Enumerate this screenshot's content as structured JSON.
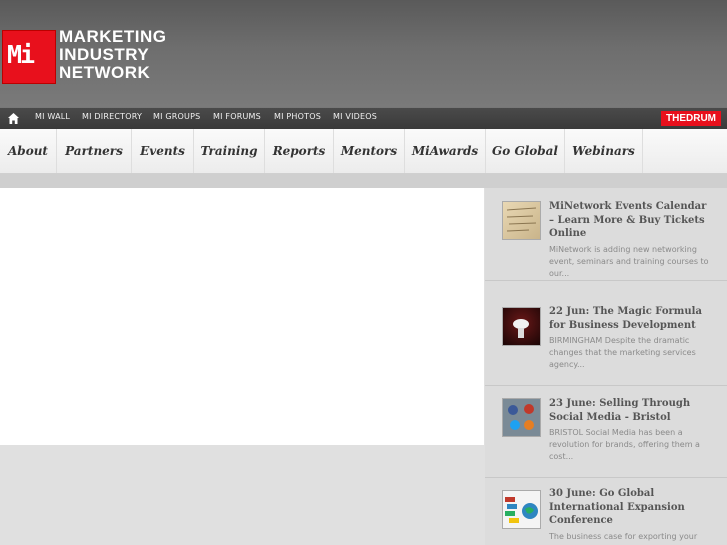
{
  "brand": {
    "logo_mark": "Mi",
    "name_lines": [
      "MARKETING",
      "INDUSTRY",
      "NETWORK"
    ]
  },
  "topnav": {
    "items": [
      "MI WALL",
      "MI DIRECTORY",
      "MI GROUPS",
      "MI FORUMS",
      "MI PHOTOS",
      "MI VIDEOS"
    ],
    "badge": "THEDRUM"
  },
  "mainnav": {
    "items": [
      "About",
      "Partners",
      "Events",
      "Training",
      "Reports",
      "Mentors",
      "MiAwards",
      "Go Global",
      "Webinars"
    ]
  },
  "sidebar": {
    "news": [
      {
        "title": "MiNetwork Events Calendar – Learn More & Buy Tickets Online",
        "excerpt": "MiNetwork is adding new networking event, seminars and training courses to our...",
        "thumb_icon": "calendar-paper-thumbnail"
      },
      {
        "title": "22 Jun: The Magic Formula for Business Development",
        "excerpt": "BIRMINGHAM Despite the dramatic changes that the marketing services agency...",
        "thumb_icon": "magic-hands-thumbnail"
      },
      {
        "title": "23 June: Selling Through Social Media - Bristol",
        "excerpt": "BRISTOL Social Media has been a revolution for brands, offering them a cost...",
        "thumb_icon": "social-media-icons-thumbnail"
      },
      {
        "title": "30 June: Go Global International Expansion Conference",
        "excerpt": "The business case for exporting your",
        "thumb_icon": "globe-flags-thumbnail"
      }
    ]
  }
}
